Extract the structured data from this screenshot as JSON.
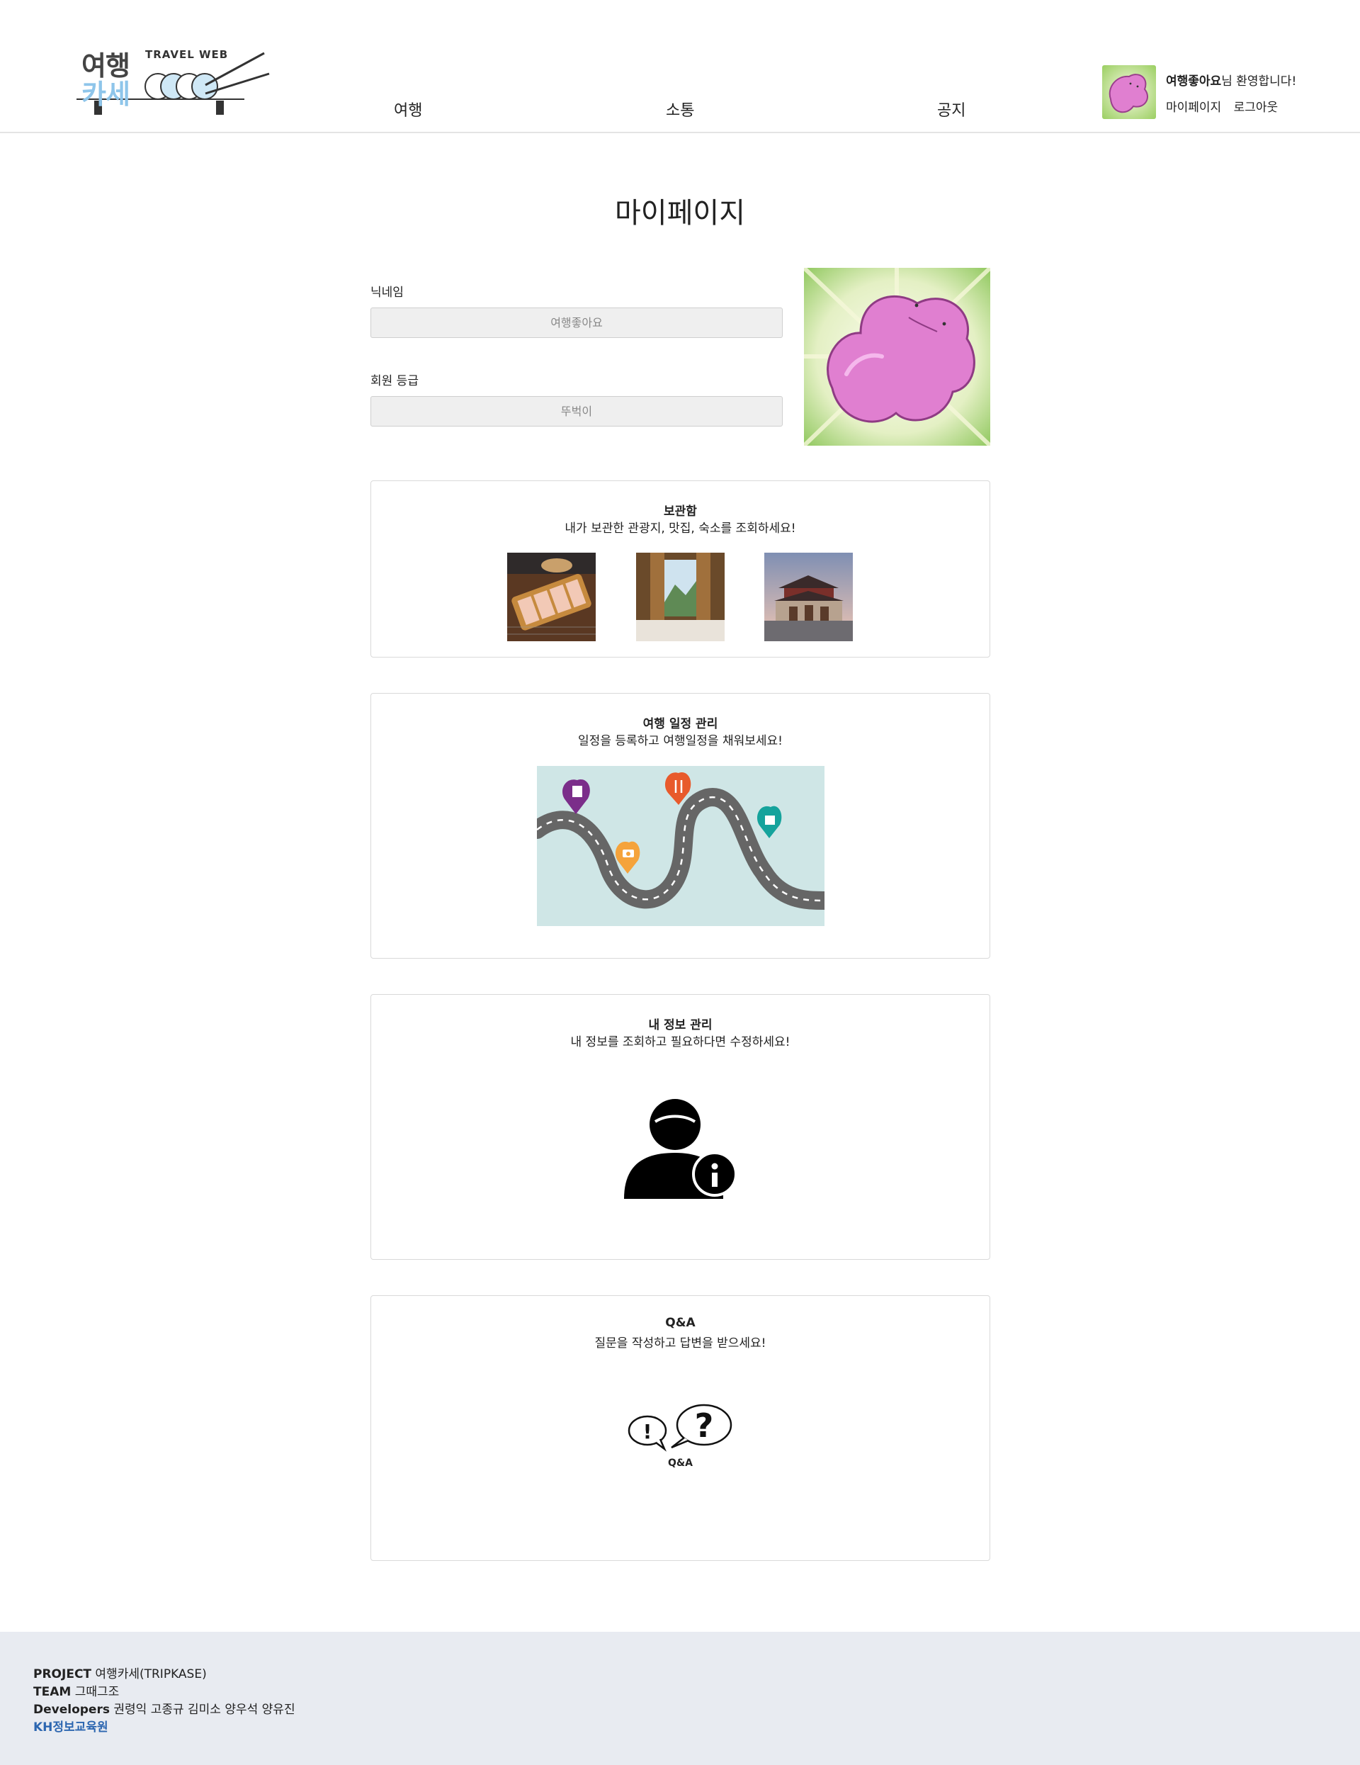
{
  "header": {
    "logo_ko_line1": "여행",
    "logo_ko_line2": "카세",
    "logo_en": "TRAVEL WEB",
    "nav": [
      "여행",
      "소통",
      "공지"
    ],
    "user_name": "여행좋아요",
    "welcome_suffix": "님 환영합니다!",
    "mypage_link": "마이페이지",
    "logout_link": "로그아웃"
  },
  "page": {
    "title": "마이페이지"
  },
  "profile": {
    "nickname_label": "닉네임",
    "nickname_value": "여행좋아요",
    "grade_label": "회원 등급",
    "grade_value": "뚜벅이"
  },
  "cards": {
    "storage": {
      "title": "보관함",
      "subtitle": "내가 보관한 관광지, 맛집, 숙소를 조회하세요!"
    },
    "schedule": {
      "title": "여행 일정 관리",
      "subtitle": "일정을 등록하고 여행일정을 채워보세요!"
    },
    "info": {
      "title": "내 정보 관리",
      "subtitle": "내 정보를 조회하고 필요하다면 수정하세요!"
    },
    "qna": {
      "title": "Q&A",
      "subtitle": "질문을 작성하고 답변을 받으세요!",
      "icon_text": "Q&A"
    }
  },
  "footer": {
    "project_label": "PROJECT",
    "project_value": "여행카세(TRIPKASE)",
    "team_label": "TEAM",
    "team_value": "그때그조",
    "dev_label": "Developers",
    "dev_value": "권령익 고종규 김미소 양우석 양유진",
    "org": "KH정보교육원"
  },
  "colors": {
    "footer_bg": "#e8ebf1",
    "org_blue": "#2c66b0",
    "logo_blue": "#8ec5ea",
    "ditto_pink": "#e07fd0",
    "map_bg": "#cfe6e6"
  }
}
